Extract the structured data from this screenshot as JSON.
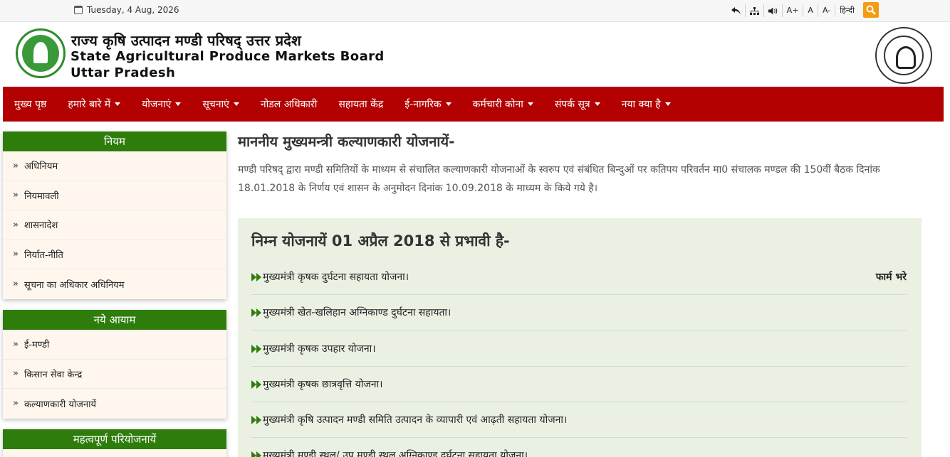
{
  "topbar": {
    "date": "Tuesday, 4 Aug, 2026",
    "tools": [
      {
        "name": "back-icon",
        "label": ""
      },
      {
        "name": "sitemap-icon",
        "label": ""
      },
      {
        "name": "speaker-icon",
        "label": ""
      },
      {
        "name": "font-increase",
        "label": "A+"
      },
      {
        "name": "font-normal",
        "label": "A"
      },
      {
        "name": "font-decrease",
        "label": "A-"
      },
      {
        "name": "language-hindi",
        "label": "हिन्दी"
      }
    ],
    "accent": "#f39c12"
  },
  "header": {
    "title_hindi": "राज्य कृषि उत्पादन मण्डी परिषद् उत्तर प्रदेश",
    "title_en_line1": "State Agricultural Produce Markets Board",
    "title_en_line2": "Uttar Pradesh"
  },
  "nav": {
    "bg": "#b30000",
    "items": [
      {
        "label": "मुख्य पृष्ठ",
        "dropdown": false
      },
      {
        "label": "हमारे बारे में",
        "dropdown": true
      },
      {
        "label": "योजनाएं",
        "dropdown": true
      },
      {
        "label": "सूचनाएं",
        "dropdown": true
      },
      {
        "label": "नोडल अधिकारी",
        "dropdown": false
      },
      {
        "label": "सहायता केंद्र",
        "dropdown": false
      },
      {
        "label": "ई-नागरिक",
        "dropdown": true
      },
      {
        "label": "कर्मचारी कोना",
        "dropdown": true
      },
      {
        "label": "संपर्क सूत्र",
        "dropdown": true
      },
      {
        "label": "नया क्या है",
        "dropdown": true
      }
    ]
  },
  "sidebar": {
    "sections": [
      {
        "title": "नियम",
        "items": [
          "अधिनियम",
          "नियमावली",
          "शासनादेश",
          "निर्यात-नीति",
          "सूचना का अधिकार अधिनियम"
        ]
      },
      {
        "title": "नये आयाम",
        "items": [
          "ई-मण्डी",
          "किसान सेवा केन्द्र",
          "कल्याणकारी योजनायें"
        ]
      },
      {
        "title": "महत्वपूर्ण परियोजनायें",
        "items": []
      }
    ]
  },
  "main": {
    "title": "माननीय मुख्यमन्त्री कल्याणकारी योजनायें-",
    "paragraph": "मण्डी परिषद् द्वारा मण्डी समितियों के माध्यम से संचालित कल्याणकारी योजनाओं के स्वरुप एवं संबंधित बिन्दुओं पर कतिपय परिवर्तन मा0 संचालक मण्डल की 150वीं बैठक दिनांक 18.01.2018 के निर्णय एवं शासन के अनुमोदन दिनांक 10.09.2018 के माध्यम के किये गये है।",
    "panel_title": "निम्न योजनायें 01 अप्रैल 2018 से प्रभावी है-",
    "form_label": "फार्म भरे",
    "schemes": [
      "मुख्यमंत्री कृषक दुर्घटना सहायता योजना।",
      "मुख्यमंत्री खेत-खलिहान अग्निकाण्ड दुर्घटना सहायता।",
      "मुख्यमंत्री कृषक उपहार योजना।",
      "मुख्यमंत्री कृषक छात्रवृत्ति योजना।",
      "मुख्यमंत्री कृषि उत्पादन मण्डी समिति उत्पादन के व्यापारी एवं आढ़ती सहायता योजना।",
      "मुख्यमंत्री मण्डी स्थल/ उप मण्डी स्थल अग्निकाण्ड दुर्घटना सहायता योजना।"
    ]
  }
}
